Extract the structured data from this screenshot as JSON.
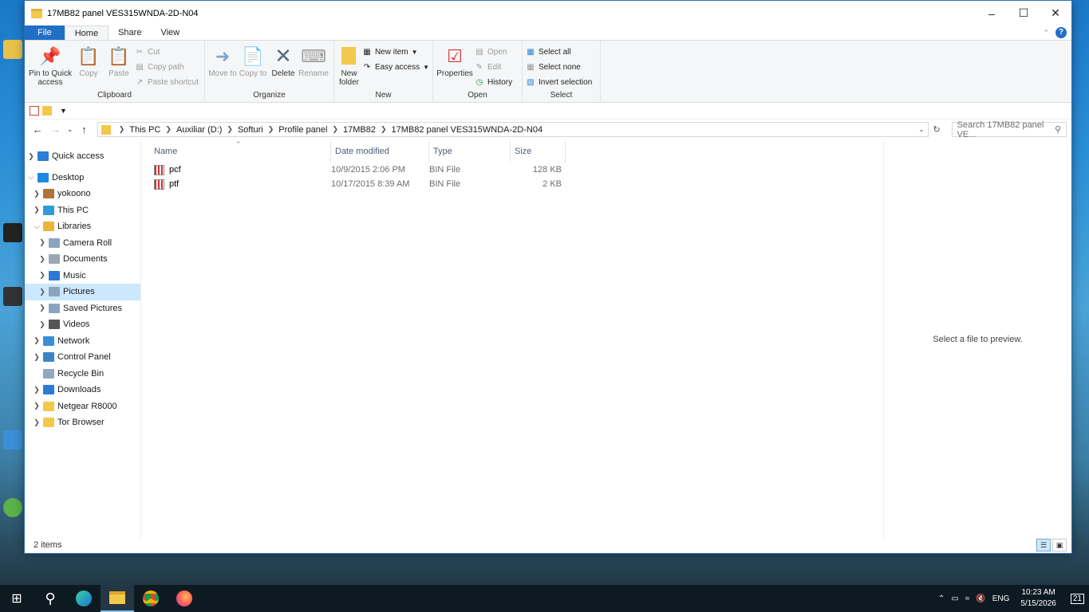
{
  "window": {
    "title": "17MB82 panel VES315WNDA-2D-N04"
  },
  "tabs": [
    "File",
    "Home",
    "Share",
    "View"
  ],
  "ribbon": {
    "clipboard": {
      "label": "Clipboard",
      "pin": "Pin to Quick access",
      "copy": "Copy",
      "paste": "Paste",
      "cut": "Cut",
      "copy_path": "Copy path",
      "paste_shortcut": "Paste shortcut"
    },
    "organize": {
      "label": "Organize",
      "move_to": "Move to",
      "copy_to": "Copy to",
      "delete": "Delete",
      "rename": "Rename"
    },
    "new": {
      "label": "New",
      "new_folder": "New folder",
      "new_item": "New item",
      "easy_access": "Easy access"
    },
    "open": {
      "label": "Open",
      "properties": "Properties",
      "open": "Open",
      "edit": "Edit",
      "history": "History"
    },
    "select": {
      "label": "Select",
      "select_all": "Select all",
      "select_none": "Select none",
      "invert": "Invert selection"
    }
  },
  "breadcrumb": [
    "This PC",
    "Auxiliar (D:)",
    "Softuri",
    "Profile panel",
    "17MB82",
    "17MB82 panel VES315WNDA-2D-N04"
  ],
  "search": {
    "placeholder": "Search 17MB82 panel VE..."
  },
  "nav": [
    {
      "label": "Quick access",
      "indent": 0,
      "chev": ">",
      "icon": "star-icon",
      "color": "#2a7fd4"
    },
    {
      "label": "Desktop",
      "indent": 0,
      "chev": "v",
      "icon": "desktop-icon",
      "color": "#1e88e5"
    },
    {
      "label": "yokoono",
      "indent": 1,
      "chev": ">",
      "icon": "user-icon",
      "color": "#b0743a"
    },
    {
      "label": "This PC",
      "indent": 1,
      "chev": ">",
      "icon": "pc-icon",
      "color": "#2d9bdc"
    },
    {
      "label": "Libraries",
      "indent": 1,
      "chev": "v",
      "icon": "libraries-icon",
      "color": "#e8b739"
    },
    {
      "label": "Camera Roll",
      "indent": 2,
      "chev": ">",
      "icon": "camera-roll-icon",
      "color": "#8aa4c0"
    },
    {
      "label": "Documents",
      "indent": 2,
      "chev": ">",
      "icon": "documents-icon",
      "color": "#9aa7b5"
    },
    {
      "label": "Music",
      "indent": 2,
      "chev": ">",
      "icon": "music-icon",
      "color": "#2b7bd6"
    },
    {
      "label": "Pictures",
      "indent": 2,
      "chev": ">",
      "icon": "pictures-icon",
      "color": "#8aa4c0",
      "selected": true
    },
    {
      "label": "Saved Pictures",
      "indent": 2,
      "chev": ">",
      "icon": "saved-pictures-icon",
      "color": "#8aa4c0"
    },
    {
      "label": "Videos",
      "indent": 2,
      "chev": ">",
      "icon": "videos-icon",
      "color": "#555"
    },
    {
      "label": "Network",
      "indent": 1,
      "chev": ">",
      "icon": "network-icon",
      "color": "#3b8ed8"
    },
    {
      "label": "Control Panel",
      "indent": 1,
      "chev": ">",
      "icon": "control-panel-icon",
      "color": "#3a86c8"
    },
    {
      "label": "Recycle Bin",
      "indent": 1,
      "chev": "",
      "icon": "recycle-bin-icon",
      "color": "#8fa9c2"
    },
    {
      "label": "Downloads",
      "indent": 1,
      "chev": ">",
      "icon": "downloads-icon",
      "color": "#2b7bd6"
    },
    {
      "label": "Netgear R8000",
      "indent": 1,
      "chev": ">",
      "icon": "folder-icon",
      "color": "#f2c94c"
    },
    {
      "label": "Tor Browser",
      "indent": 1,
      "chev": ">",
      "icon": "folder-icon",
      "color": "#f2c94c"
    }
  ],
  "columns": {
    "name": "Name",
    "date": "Date modified",
    "type": "Type",
    "size": "Size"
  },
  "files": [
    {
      "name": "pcf",
      "date": "10/9/2015 2:06 PM",
      "type": "BIN File",
      "size": "128 KB"
    },
    {
      "name": "ptf",
      "date": "10/17/2015 8:39 AM",
      "type": "BIN File",
      "size": "2 KB"
    }
  ],
  "preview": "Select a file to preview.",
  "status": "2 items",
  "tray": {
    "lang": "ENG",
    "time": "10:23 AM",
    "date": "5/15/2026",
    "notif": "21"
  }
}
